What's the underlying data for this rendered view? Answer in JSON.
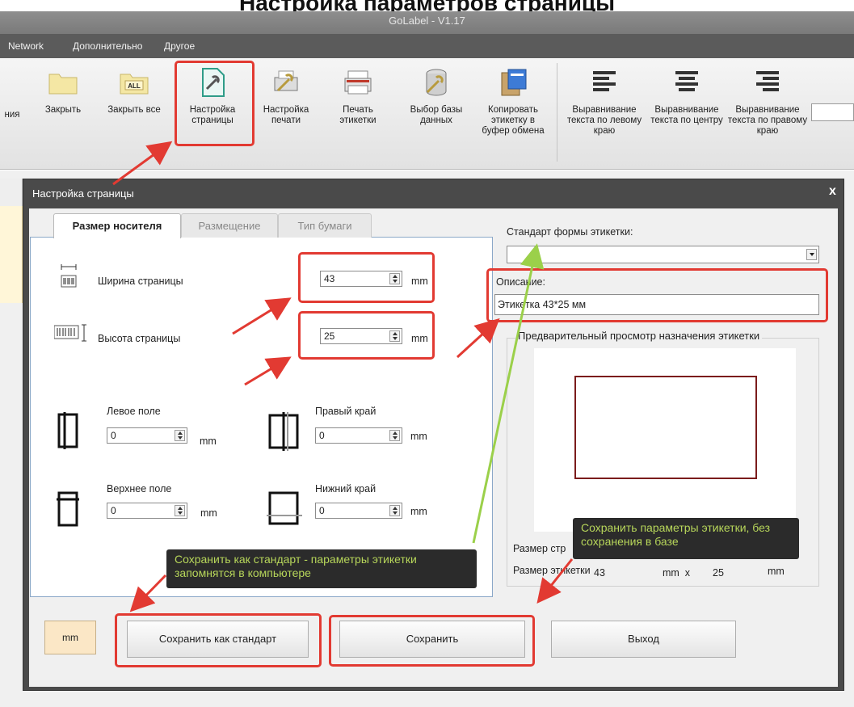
{
  "headline": "Настройка параметров страницы",
  "window_title": "GoLabel - V1.17",
  "menu": [
    "Network",
    "Дополнительно",
    "Другое"
  ],
  "ribbon": {
    "partial_label": "ния",
    "buttons": [
      {
        "label": "Закрыть",
        "icon": "folder-icon"
      },
      {
        "label": "Закрыть все",
        "icon": "folder-all-icon",
        "badge": "ALL"
      },
      {
        "label": "Настройка страницы",
        "icon": "page-setup-icon"
      },
      {
        "label": "Настройка печати",
        "icon": "print-setup-icon"
      },
      {
        "label": "Печать этикетки",
        "icon": "printer-icon"
      },
      {
        "label": "Выбор базы данных",
        "icon": "database-icon"
      },
      {
        "label": "Копировать этикетку в буфер обмена",
        "icon": "clipboard-icon"
      },
      {
        "label": "Выравнивание текста по левому краю",
        "icon": "align-left-icon"
      },
      {
        "label": "Выравнивание текста по центру",
        "icon": "align-center-icon"
      },
      {
        "label": "Выравнивание текста по правому краю",
        "icon": "align-right-icon"
      }
    ]
  },
  "dialog": {
    "title": "Настройка страницы",
    "close": "x",
    "tabs": [
      "Размер носителя",
      "Размещение",
      "Тип бумаги"
    ],
    "active_tab": 0,
    "fields": {
      "page_width": {
        "label": "Ширина страницы",
        "value": "43",
        "unit": "mm"
      },
      "page_height": {
        "label": "Высота страницы",
        "value": "25",
        "unit": "mm"
      },
      "left_margin": {
        "label": "Левое поле",
        "value": "0",
        "unit": "mm"
      },
      "right_margin": {
        "label": "Правый край",
        "value": "0",
        "unit": "mm"
      },
      "top_margin": {
        "label": "Верхнее поле",
        "value": "0",
        "unit": "mm"
      },
      "bottom_margin": {
        "label": "Нижний край",
        "value": "0",
        "unit": "mm"
      }
    },
    "standard_label": "Стандарт формы этикетки:",
    "standard_value": "",
    "description_label": "Описание:",
    "description_value": "Этикетка 43*25 мм",
    "preview_title": "Предварительный просмотр назначения этикетки",
    "page_size_label": "Размер стр",
    "page_size_unit": "mm",
    "label_size_label": "Размер этикетки",
    "label_size_w": "43",
    "label_size_sep": "mm  x",
    "label_size_h": "25",
    "label_size_unit": "mm",
    "units_button": "mm",
    "buttons": {
      "save_standard": "Сохранить как стандарт",
      "save": "Сохранить",
      "exit": "Выход"
    }
  },
  "tooltips": {
    "save_standard": "Сохранить как стандарт - параметры этикетки запомнятся в компьютере",
    "save": "Сохранить параметры этикетки, без сохранения в базе"
  },
  "colors": {
    "annotation_red": "#e23a32",
    "annotation_green": "#9bd04a",
    "tooltip_text": "#b7d65a",
    "label_outline": "#7b1c1c"
  }
}
